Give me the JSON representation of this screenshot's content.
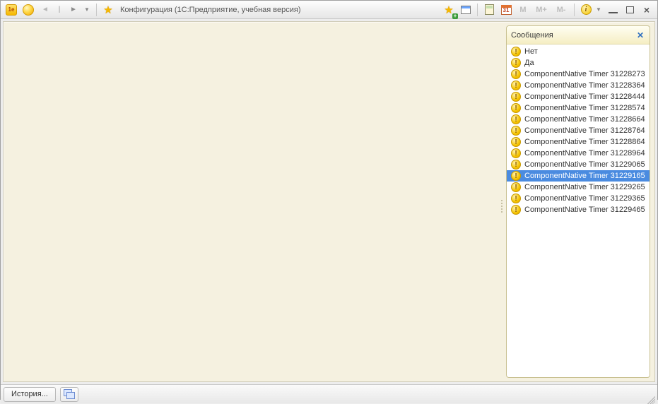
{
  "toolbar": {
    "app_badge": "1e",
    "title": "Конфигурация  (1С:Предприятие, учебная версия)",
    "calendar_day": "31",
    "m_buttons": [
      "M",
      "M+",
      "M-"
    ]
  },
  "messages_panel": {
    "title": "Сообщения",
    "selected_index": 11,
    "items": [
      "Нет",
      "Да",
      "ComponentNative Timer 31228273",
      "ComponentNative Timer 31228364",
      "ComponentNative Timer 31228444",
      "ComponentNative Timer 31228574",
      "ComponentNative Timer 31228664",
      "ComponentNative Timer 31228764",
      "ComponentNative Timer 31228864",
      "ComponentNative Timer 31228964",
      "ComponentNative Timer 31229065",
      "ComponentNative Timer 31229165",
      "ComponentNative Timer 31229265",
      "ComponentNative Timer 31229365",
      "ComponentNative Timer 31229465"
    ]
  },
  "bottombar": {
    "history_label": "История..."
  }
}
